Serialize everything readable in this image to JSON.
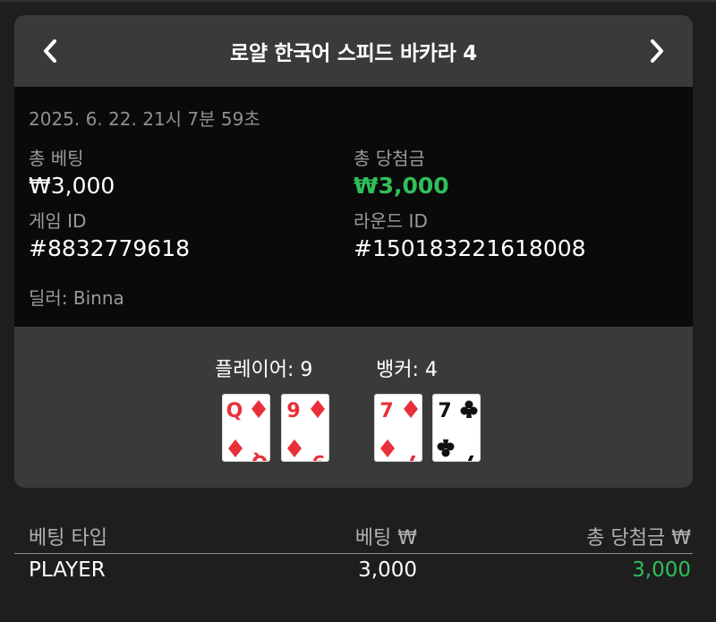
{
  "header": {
    "title": "로얄 한국어 스피드 바카라 4"
  },
  "info": {
    "timestamp": "2025. 6. 22. 21시 7분 59초",
    "total_bet_label": "총 베팅",
    "total_bet_value": "₩3,000",
    "total_win_label": "총 당첨금",
    "total_win_value": "₩3,000",
    "game_id_label": "게임 ID",
    "game_id_value": "#8832779618",
    "round_id_label": "라운드 ID",
    "round_id_value": "#150183221618008",
    "dealer": "딜러: Binna"
  },
  "results": {
    "player_label": "플레이어: 9",
    "banker_label": "뱅커: 4",
    "player_cards": [
      {
        "rank": "Q",
        "suit": "diamond",
        "color": "#e8303a"
      },
      {
        "rank": "9",
        "suit": "diamond",
        "color": "#e8303a"
      }
    ],
    "banker_cards": [
      {
        "rank": "7",
        "suit": "diamond",
        "color": "#e8303a"
      },
      {
        "rank": "7",
        "suit": "club",
        "color": "#111111"
      }
    ]
  },
  "bet_table": {
    "headers": [
      "베팅 타입",
      "베팅 ₩",
      "총 당첨금 ₩"
    ],
    "rows": [
      {
        "type": "PLAYER",
        "bet": "3,000",
        "win": "3,000"
      }
    ]
  },
  "colors": {
    "win_green": "#2fbf5a",
    "card_red": "#e8303a",
    "panel_bg": "#3a3a3a",
    "info_bg": "#0a0a0a"
  }
}
